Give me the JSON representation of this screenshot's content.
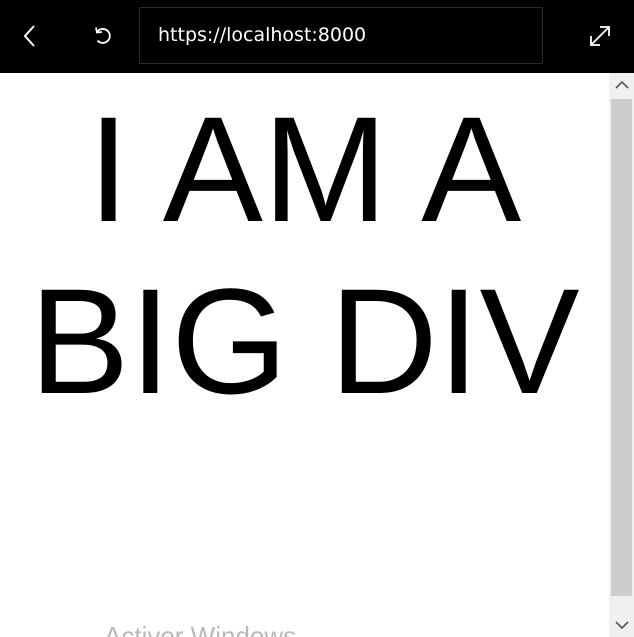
{
  "toolbar": {
    "back_icon": "chevron-left-icon",
    "refresh_icon": "refresh-icon",
    "address": "https://localhost:8000",
    "expand_icon": "expand-icon"
  },
  "page": {
    "heading": "I AM A BIG DIV"
  },
  "overlay": {
    "watermark": "Activer Windows"
  },
  "scrollbar": {
    "up_icon": "chevron-up-icon",
    "down_icon": "chevron-down-icon",
    "position_fraction": 0.0
  }
}
